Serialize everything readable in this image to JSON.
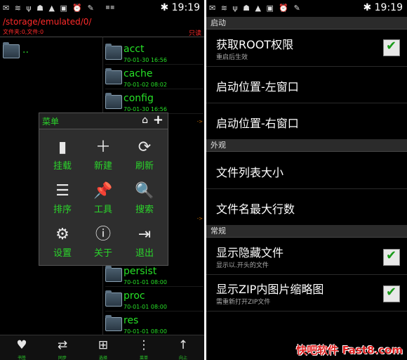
{
  "status": {
    "time": "19:19",
    "bluetooth_icon": "bluetooth-icon"
  },
  "left": {
    "path": "/storage/emulated/0/",
    "counts": "文件夹:0,文件:0",
    "mode": "只读",
    "parent_label": "..",
    "files": [
      {
        "name": "acct",
        "date": "70-01-30 16:56"
      },
      {
        "name": "cache",
        "date": "70-01-02 08:02"
      },
      {
        "name": "config",
        "date": "70-01-30 16:56"
      },
      {
        "name": "persist",
        "date": "70-01-01 08:00"
      },
      {
        "name": "proc",
        "date": "70-01-01 08:00"
      },
      {
        "name": "res",
        "date": "70-01-01 08:00"
      }
    ],
    "menu": {
      "title": "菜单",
      "items": [
        {
          "label": "挂载",
          "icon": "sdcard-icon",
          "glyph": "▮"
        },
        {
          "label": "新建",
          "icon": "plus-icon",
          "glyph": "＋"
        },
        {
          "label": "刷新",
          "icon": "refresh-icon",
          "glyph": "⟳"
        },
        {
          "label": "排序",
          "icon": "sort-icon",
          "glyph": "☰"
        },
        {
          "label": "工具",
          "icon": "pin-icon",
          "glyph": "📌"
        },
        {
          "label": "搜索",
          "icon": "search-icon",
          "glyph": "🔍"
        },
        {
          "label": "设置",
          "icon": "gear-icon",
          "glyph": "⚙"
        },
        {
          "label": "关于",
          "icon": "info-icon",
          "glyph": "ⓘ"
        },
        {
          "label": "退出",
          "icon": "exit-icon",
          "glyph": "⇥"
        }
      ]
    },
    "bottom": [
      {
        "label": "书签",
        "icon": "heart-icon",
        "glyph": "♥"
      },
      {
        "label": "同步",
        "icon": "swap-icon",
        "glyph": "⇄"
      },
      {
        "label": "选择",
        "icon": "select-icon",
        "glyph": "⊞"
      },
      {
        "label": "菜单",
        "icon": "menu-icon",
        "glyph": "⋮"
      },
      {
        "label": "向上",
        "icon": "up-arrow-icon",
        "glyph": "↑"
      }
    ]
  },
  "right": {
    "sections": [
      "启动",
      "外观",
      "常规"
    ],
    "items": [
      {
        "title": "获取ROOT权限",
        "summary": "重启后生效",
        "checked": true
      },
      {
        "title": "启动位置-左窗口"
      },
      {
        "title": "启动位置-右窗口"
      },
      {
        "title": "文件列表大小"
      },
      {
        "title": "文件名最大行数"
      },
      {
        "title": "显示隐藏文件",
        "summary": "显示以.开头的文件",
        "checked": true
      },
      {
        "title": "显示ZIP内图片缩略图",
        "summary": "需重新打开ZIP文件",
        "checked": true
      }
    ],
    "check_mark": "✔"
  },
  "watermark": "快吧软件 Fast8.com"
}
